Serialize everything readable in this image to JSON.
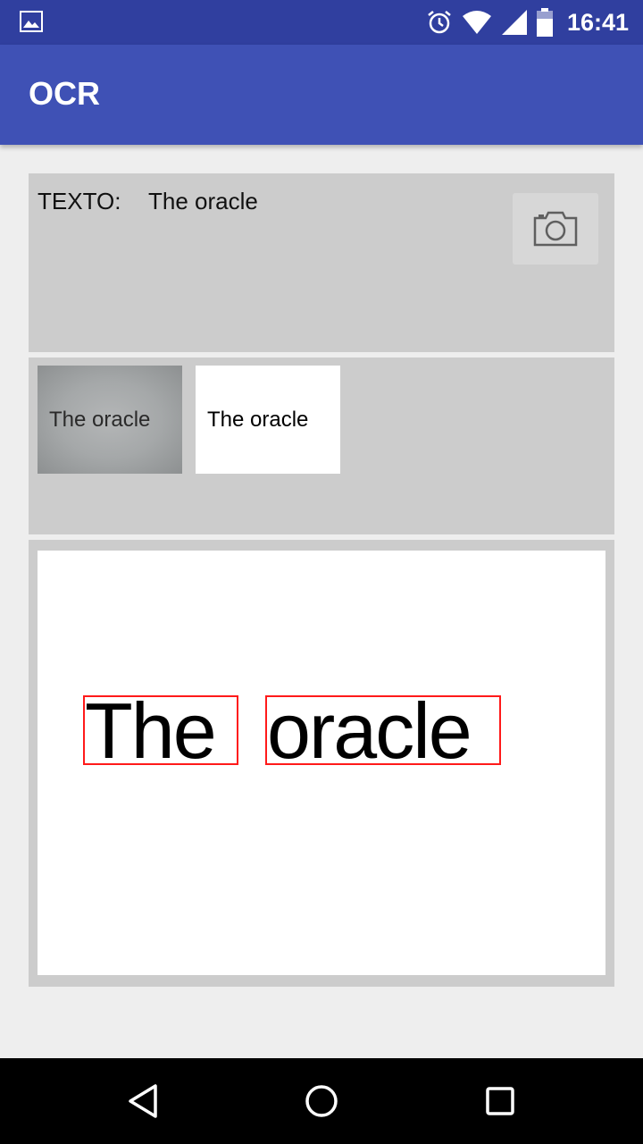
{
  "status_bar": {
    "time": "16:41",
    "icons": [
      "gallery-icon",
      "alarm-icon",
      "wifi-icon",
      "signal-icon",
      "battery-icon"
    ]
  },
  "app_bar": {
    "title": "OCR"
  },
  "text_panel": {
    "label": "TEXTO:",
    "value": "The oracle",
    "camera_icon": "camera-icon"
  },
  "thumbnails": {
    "original_text": "The oracle",
    "processed_text": "The oracle"
  },
  "result": {
    "words": [
      "The",
      "oracle"
    ],
    "box_color": "#ff1a1a"
  },
  "nav_bar": {
    "icons": [
      "back-icon",
      "home-icon",
      "recents-icon"
    ]
  },
  "colors": {
    "primary": "#3f51b5",
    "primary_dark": "#303f9f",
    "panel": "#cccccc",
    "background": "#eeeeee"
  }
}
